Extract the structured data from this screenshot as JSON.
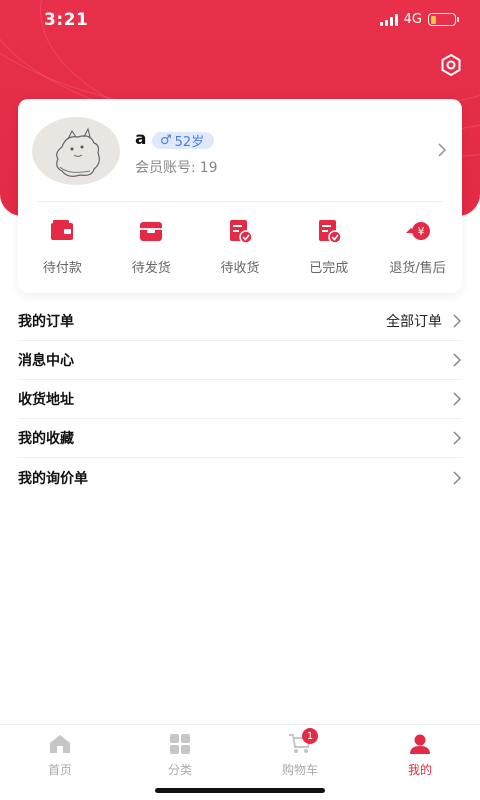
{
  "status_bar": {
    "time": "3:21",
    "network": "4G"
  },
  "theme": {
    "accent": "#e42a44",
    "badge_bg": "#dfe9fb",
    "badge_text": "#4a7de0"
  },
  "profile": {
    "name": "a",
    "gender_symbol": "♂",
    "age": "52岁",
    "member_label": "会员账号:",
    "member_id": "19"
  },
  "orders": [
    {
      "label": "待付款",
      "icon": "wallet-icon"
    },
    {
      "label": "待发货",
      "icon": "box-icon"
    },
    {
      "label": "待收货",
      "icon": "receive-doc-icon"
    },
    {
      "label": "已完成",
      "icon": "done-doc-icon"
    },
    {
      "label": "退货/售后",
      "icon": "refund-icon"
    }
  ],
  "menu": [
    {
      "label": "我的订单",
      "extra": "全部订单"
    },
    {
      "label": "消息中心"
    },
    {
      "label": "收货地址"
    },
    {
      "label": "我的收藏"
    },
    {
      "label": "我的询价单"
    }
  ],
  "tabbar": [
    {
      "label": "首页",
      "icon": "home-icon"
    },
    {
      "label": "分类",
      "icon": "grid-icon"
    },
    {
      "label": "购物车",
      "icon": "cart-icon",
      "badge": "1"
    },
    {
      "label": "我的",
      "icon": "user-icon",
      "active": true
    }
  ]
}
